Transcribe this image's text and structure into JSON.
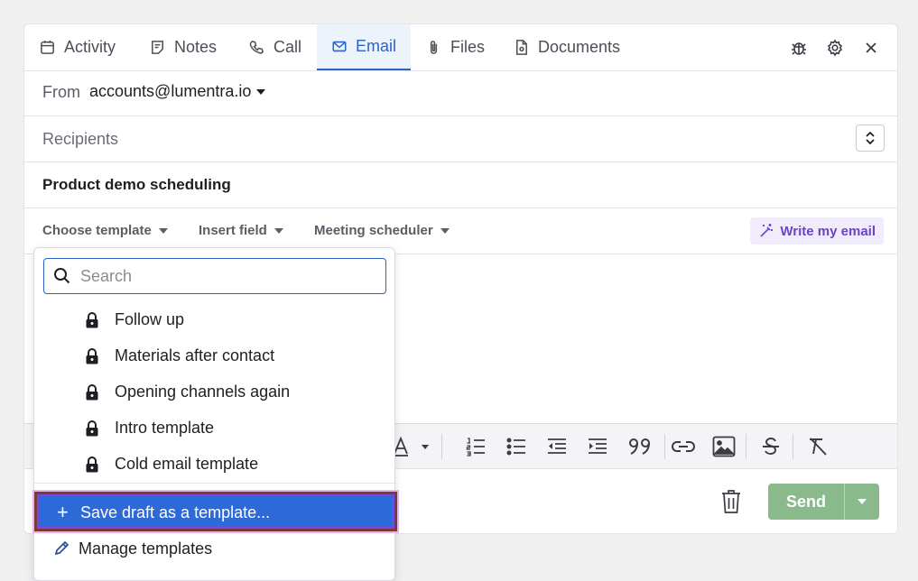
{
  "tabs": [
    {
      "label": "Activity",
      "icon": "calendar-icon"
    },
    {
      "label": "Notes",
      "icon": "notes-icon"
    },
    {
      "label": "Call",
      "icon": "phone-icon"
    },
    {
      "label": "Email",
      "icon": "mail-icon",
      "active": true
    },
    {
      "label": "Files",
      "icon": "paperclip-icon"
    },
    {
      "label": "Documents",
      "icon": "document-icon"
    }
  ],
  "header_icons": [
    "bug-icon",
    "gear-icon",
    "close-icon"
  ],
  "from": {
    "label": "From",
    "value": "accounts@lumentra.io"
  },
  "recipients": {
    "label": "Recipients"
  },
  "subject": "Product demo scheduling",
  "toolbar": {
    "choose_template": "Choose template",
    "insert_field": "Insert field",
    "meeting_scheduler": "Meeting scheduler",
    "write_my_email": "Write my email"
  },
  "template_dropdown": {
    "search_placeholder": "Search",
    "search_value": "",
    "items": [
      {
        "label": "Follow up",
        "locked": true
      },
      {
        "label": "Materials after contact",
        "locked": true
      },
      {
        "label": "Opening channels again",
        "locked": true
      },
      {
        "label": "Intro template",
        "locked": true
      },
      {
        "label": "Cold email template",
        "locked": true
      }
    ],
    "save_draft": "Save draft as a template...",
    "manage": "Manage templates"
  },
  "send": {
    "label": "Send"
  },
  "colors": {
    "accent": "#2c64c4",
    "send_green": "#8ab98b",
    "highlight": "#2d6ad8",
    "ai_purple": "#6a44c4"
  }
}
